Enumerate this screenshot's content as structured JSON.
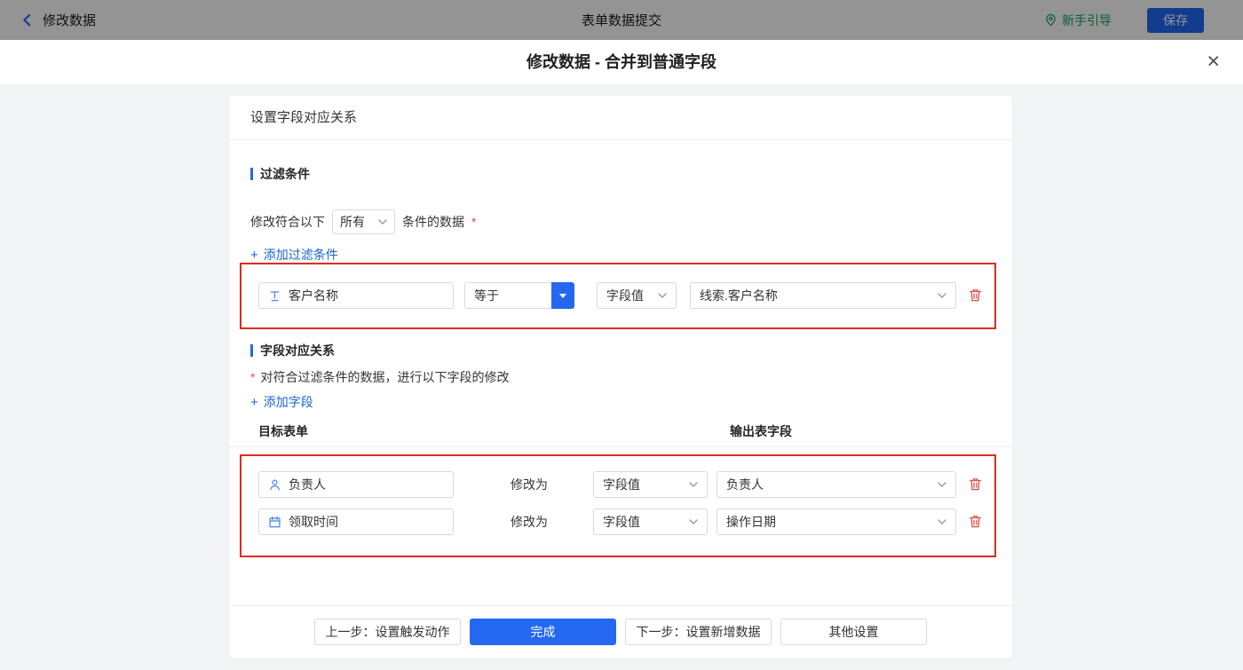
{
  "topbar": {
    "back_label": "修改数据",
    "title": "表单数据提交",
    "guide_label": "新手引导",
    "save_label": "保存"
  },
  "modal": {
    "title": "修改数据 - 合并到普通字段",
    "close_glyph": "×"
  },
  "panel": {
    "header": "设置字段对应关系"
  },
  "filter": {
    "title": "过滤条件",
    "line_prefix": "修改符合以下",
    "scope_value": "所有",
    "line_suffix": "条件的数据",
    "required_mark": "*",
    "add_plus": "+",
    "add_label": "添加过滤条件",
    "row": {
      "field": "客户名称",
      "operator": "等于",
      "value_type": "字段值",
      "value": "线索.客户名称"
    }
  },
  "mapping": {
    "title": "字段对应关系",
    "required_mark": "*",
    "description": "对符合过滤条件的数据，进行以下字段的修改",
    "add_plus": "+",
    "add_label": "添加字段",
    "col_target": "目标表单",
    "col_output": "输出表字段",
    "modify_label": "修改为",
    "rows": [
      {
        "field": "负责人",
        "value_type": "字段值",
        "value": "负责人"
      },
      {
        "field": "领取时间",
        "value_type": "字段值",
        "value": "操作日期"
      }
    ]
  },
  "footer": {
    "prev_label": "上一步：设置触发动作",
    "done_label": "完成",
    "next_label": "下一步：设置新增数据",
    "other_label": "其他设置"
  },
  "colors": {
    "accent_blue": "#2468f2",
    "link_blue": "#1765d1",
    "danger_red": "#e34d43",
    "highlight_red": "#e02b20",
    "guide_green": "#13a35f"
  }
}
